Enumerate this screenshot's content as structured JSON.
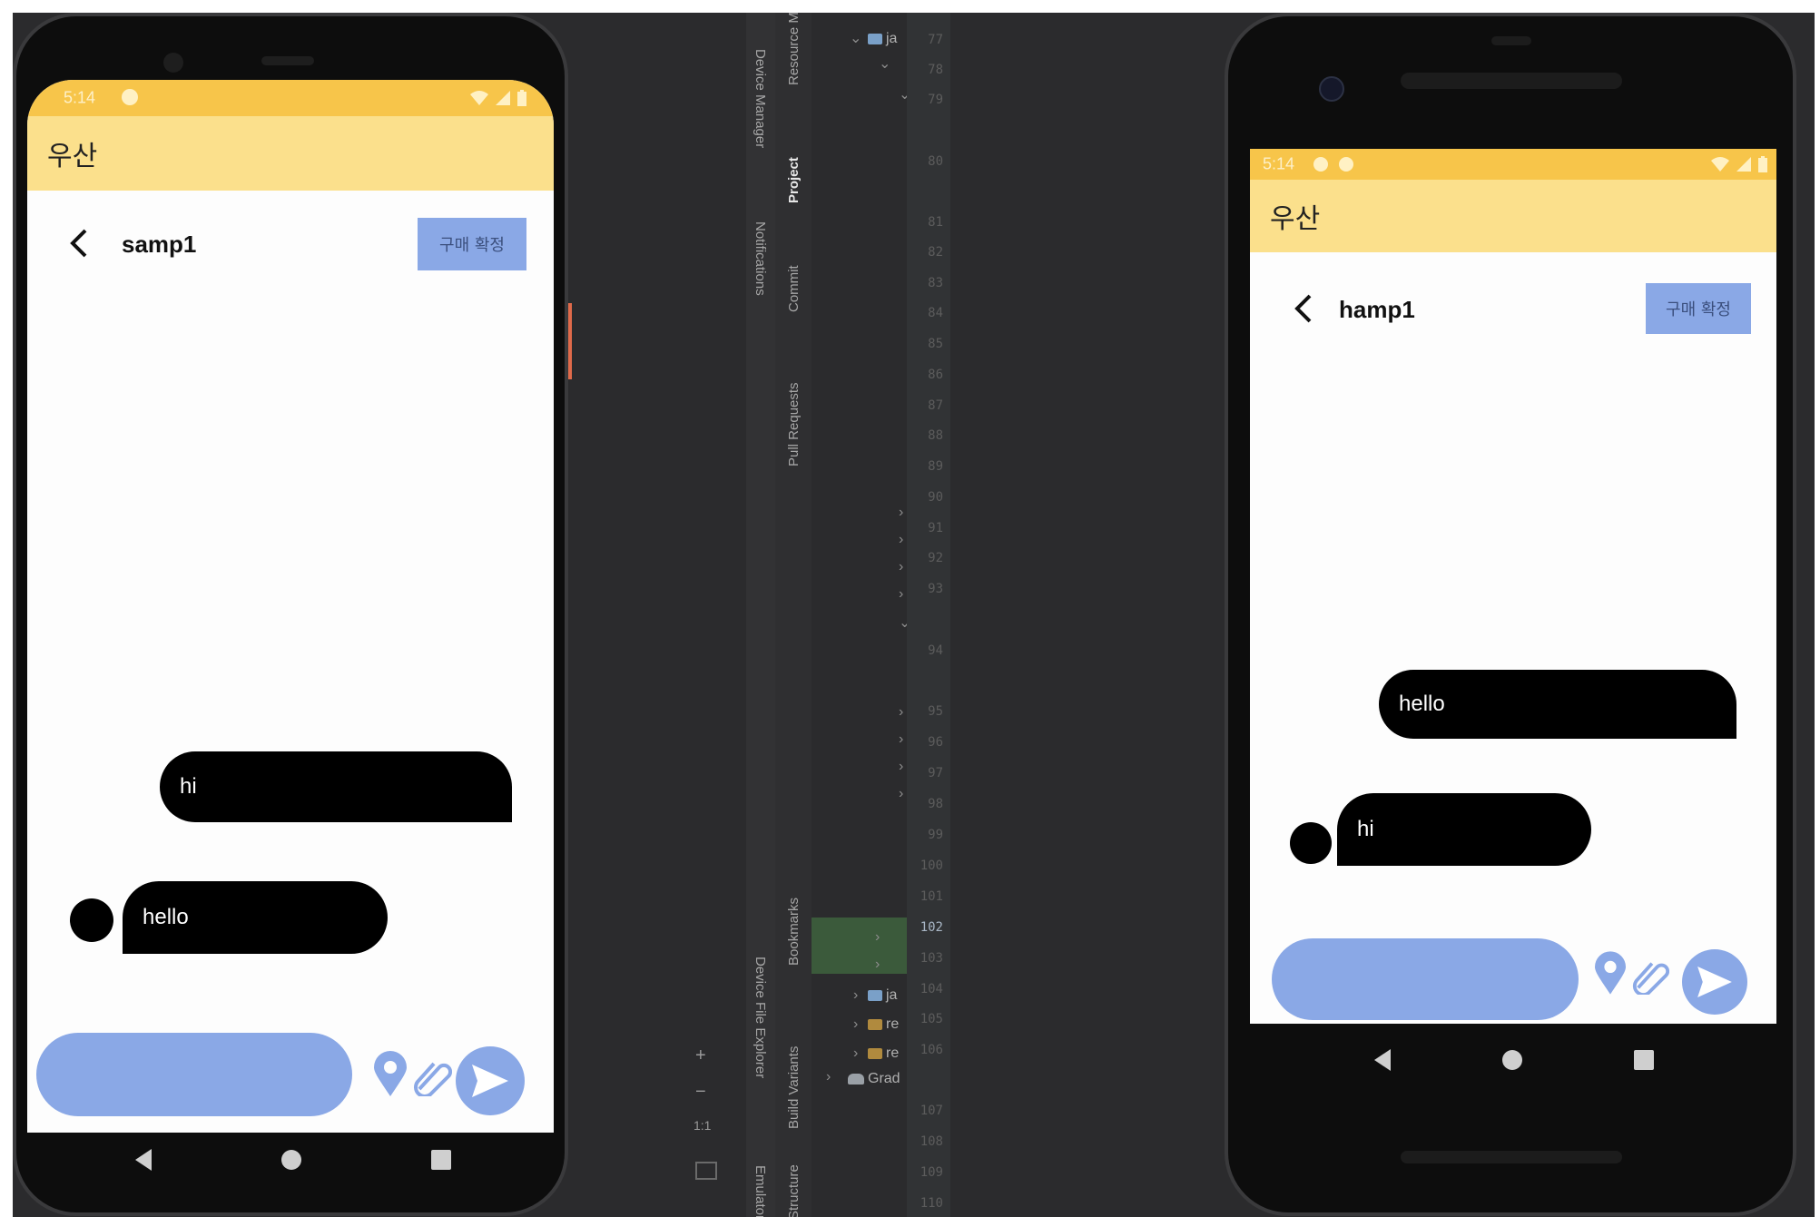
{
  "left_phone": {
    "status_time": "5:14",
    "app_title": "우산",
    "chat_name": "samp1",
    "confirm_button": "구매 확정",
    "messages": [
      {
        "text": "hi",
        "side": "right"
      },
      {
        "text": "hello",
        "side": "left"
      }
    ]
  },
  "right_phone": {
    "status_time": "5:14",
    "app_title": "우산",
    "chat_name": "hamp1",
    "confirm_button": "구매 확정",
    "messages": [
      {
        "text": "hello",
        "side": "right"
      },
      {
        "text": "hi",
        "side": "left"
      }
    ]
  },
  "ide": {
    "tool_windows": [
      "Resource Manager",
      "Project",
      "Commit",
      "Pull Requests",
      "Bookmarks",
      "Build Variants",
      "Structure"
    ],
    "side_panels": [
      "Device Manager",
      "Notifications",
      "Device File Explorer",
      "Emulator"
    ],
    "tree_items": [
      "ja",
      "ja",
      "re",
      "re",
      "Grad"
    ],
    "line_numbers": [
      "77",
      "78",
      "79",
      "80",
      "81",
      "82",
      "83",
      "84",
      "85",
      "86",
      "87",
      "88",
      "89",
      "90",
      "91",
      "92",
      "93",
      "94",
      "95",
      "96",
      "97",
      "98",
      "99",
      "100",
      "101",
      "102",
      "103",
      "104",
      "105",
      "106",
      "107",
      "108",
      "109",
      "110"
    ],
    "zoom": {
      "plus": "+",
      "minus": "−",
      "ratio": "1:1"
    }
  },
  "colors": {
    "status_bar": "#f7c54a",
    "app_bar": "#fbe08c",
    "accent_blue": "#8aa8e6",
    "bubble": "#000000",
    "ide_bg": "#2b2b2d"
  }
}
